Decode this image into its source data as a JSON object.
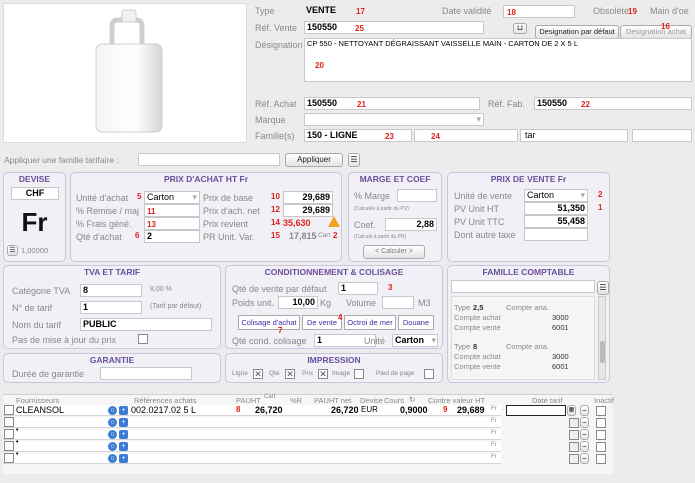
{
  "header": {
    "type_label": "Type",
    "type_value": "VENTE",
    "type_badge": "17",
    "date_label": "Date validité",
    "date_badge": "18",
    "obsolete_label": "Obsolète",
    "obsolete_badge": "19",
    "main_label": "Main d'oe",
    "ref_vente_label": "Réf. Vente",
    "ref_vente_value": "150550",
    "ref_vente_badge": "25",
    "designation_default_button": "Designation par défaut",
    "designation_achat_button": "Designation achat",
    "designation_achat_badge": "16",
    "designation_label": "Désignation",
    "designation_value": "CP 550 - NETTOYANT DÉGRAISSANT VAISSELLE MAIN - CARTON DE 2 X 5 L",
    "designation_badge": "20",
    "ref_achat_label": "Réf. Achat",
    "ref_achat_value": "150550",
    "ref_achat_badge": "21",
    "ref_fab_label": "Réf. Fab.",
    "ref_fab_value": "150550",
    "ref_fab_badge": "22",
    "marque_label": "Marque",
    "familles_label": "Famille(s)",
    "famille_value": "150 - LIGNE",
    "famille_badge": "23",
    "famille2_badge": "24",
    "tar_value": "tar"
  },
  "apply_family": {
    "label": "Appliquer une famille tarifaire :",
    "button": "Appliquer"
  },
  "devise": {
    "title": "DEVISE",
    "code": "CHF",
    "symbol": "Fr",
    "rate": "1,00000"
  },
  "prix_achat": {
    "title": "PRIX D'ACHAT HT",
    "currency": "Fr",
    "unite_label": "Unité d'achat",
    "unite_badge": "5",
    "unite_value": "Carton",
    "remise_label": "% Remise / maj",
    "remise_badge": "11",
    "frais_label": "% Frais géné.",
    "frais_badge": "13",
    "qte_label": "Qté d'achat",
    "qte_badge": "6",
    "qte_value": "2",
    "base_label": "Prix de base",
    "base_badge": "10",
    "base_value": "29,689",
    "net_label": "Prix d'ach. net",
    "net_badge": "12",
    "net_value": "29,689",
    "revient_label": "Prix revient",
    "revient_badge": "14",
    "revient_value": "35,630",
    "pr_unit_label": "PR Unit. Var.",
    "pr_unit_badge": "15",
    "pr_unit_value": "17,815",
    "cart_label": "Cart",
    "cart_badge": "2"
  },
  "marge": {
    "title": "MARGE ET COEF",
    "marge_label": "% Marge",
    "marge_hint": "(Calculée à partir du PV)",
    "coef_label": "Coef.",
    "coef_value": "2,88",
    "coef_hint": "(Calculé à partir du PR)",
    "calc_button": "< Calculer >"
  },
  "prix_vente": {
    "title": "PRIX DE VENTE",
    "currency": "Fr",
    "unite_label": "Unité de vente",
    "unite_value": "Carton",
    "unite_badge": "2",
    "pv_ht_label": "PV Unit HT",
    "pv_ht_value": "51,350",
    "pv_ht_badge": "1",
    "pv_ttc_label": "PV Unit TTC",
    "pv_ttc_value": "55,458",
    "autre_taxe_label": "Dont autre taxe"
  },
  "tva": {
    "title": "TVA ET TARIF",
    "cat_label": "Catégorie TVA",
    "cat_value": "8",
    "cat_rate": "8,00 %",
    "tarif_no_label": "N° de tarif",
    "tarif_no_value": "1",
    "tarif_hint": "(Tarif par défaut)",
    "tarif_nom_label": "Nom du tarif",
    "tarif_nom_value": "PUBLIC",
    "pas_maj_label": "Pas de mise à jour du prix"
  },
  "conditionnement": {
    "title": "CONDITIONNEMENT & COLISAGE",
    "qte_label": "Qté de vente par défaut",
    "qte_value": "1",
    "qte_badge": "3",
    "poids_label": "Poids unit.",
    "poids_value": "10,00",
    "poids_unit": "Kg",
    "volume_label": "Volume",
    "volume_unit": "M3",
    "tabs": [
      "Colisage d'achat",
      "De vente",
      "Octroi de mer",
      "Douane"
    ],
    "tab_badge_1": "7",
    "tab_badge_2": "4",
    "cond_label": "Qté cond. colisage",
    "cond_value": "1",
    "unite_label": "Unité",
    "unite_value": "Carton"
  },
  "famille_comptable": {
    "title": "FAMILLE COMPTABLE",
    "entries": [
      {
        "type_label": "Type",
        "type_value": "2,5",
        "compte_label": "Compte ana.",
        "achat_label": "Compte achat",
        "achat_value": "3000",
        "vente_label": "Compte vente",
        "vente_value": "6001"
      },
      {
        "type_label": "Type",
        "type_value": "8",
        "compte_label": "Compte ana.",
        "achat_label": "Compte achat",
        "achat_value": "3000",
        "vente_label": "Compte vente",
        "vente_value": "6001"
      }
    ]
  },
  "garantie": {
    "title": "GARANTIE",
    "duree_label": "Durée de garantie"
  },
  "impression": {
    "title": "IMPRESSION",
    "items": [
      "Ligne",
      "Qté",
      "Prix",
      "Image",
      "Pied de page"
    ]
  },
  "grid": {
    "headers": [
      "Fournisseurs",
      "Références achats",
      "PAUHT",
      "Cart",
      "%R",
      "PAUHT net",
      "Devise",
      "Cours",
      "Contre valeur HT",
      "Date tarif",
      "Inactif"
    ],
    "rows": [
      {
        "fournisseur": "CLEANSOL",
        "reference": "002.0217.02 5 L",
        "badge_a": "8",
        "pauht": "26,720",
        "pauht_net": "26,720",
        "devise": "EUR",
        "cours": "0,9000",
        "badge_b": "9",
        "contre_valeur": "29,689",
        "curr": "Fr"
      },
      {
        "fournisseur": "",
        "reference": "",
        "badge_a": "",
        "pauht": "",
        "pauht_net": "",
        "devise": "",
        "cours": "",
        "badge_b": "",
        "contre_valeur": "",
        "curr": "Fr"
      },
      {
        "fournisseur": "•",
        "reference": "",
        "badge_a": "",
        "pauht": "",
        "pauht_net": "",
        "devise": "",
        "cours": "",
        "badge_b": "",
        "contre_valeur": "",
        "curr": "Fr"
      },
      {
        "fournisseur": "•",
        "reference": "",
        "badge_a": "",
        "pauht": "",
        "pauht_net": "",
        "devise": "",
        "cours": "",
        "badge_b": "",
        "contre_valeur": "",
        "curr": "Fr"
      },
      {
        "fournisseur": "•",
        "reference": "",
        "badge_a": "",
        "pauht": "",
        "pauht_net": "",
        "devise": "",
        "cours": "",
        "badge_b": "",
        "contre_valeur": "",
        "curr": "Fr"
      }
    ]
  },
  "colors": {
    "accent": "#6a4f9a",
    "badge": "#e0221a",
    "warning": "#f2a21a"
  },
  "icons": [
    "product-image",
    "list-icon",
    "search-icon",
    "add-icon",
    "warning-icon",
    "scroll-icon"
  ]
}
